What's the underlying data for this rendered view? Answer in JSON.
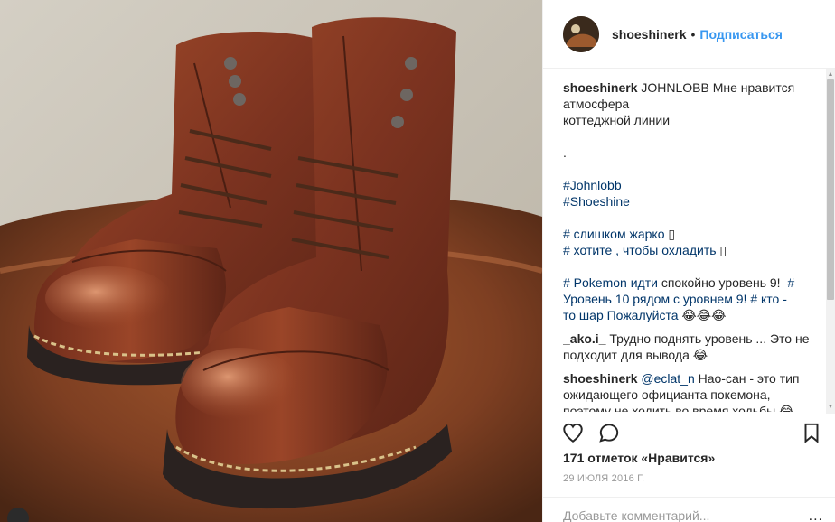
{
  "header": {
    "username": "shoeshinerk",
    "separator": "•",
    "follow_label": "Подписаться"
  },
  "caption": {
    "username": "shoeshinerk",
    "line1": " JOHNLOBB Мне нравится",
    "line2": "атмосфера",
    "line3": "коттеджной линии",
    "dot": ".",
    "tag_johnlobb": "#Johnlobb",
    "tag_shoeshine": "#Shoeshine",
    "tag_hot": "# слишком жарко",
    "hot_emoji": "▯",
    "tag_cool": "# хотите , чтобы охладить",
    "cool_emoji": "▯",
    "tag_pokemon": "# Pokemon идти",
    "pokemon_rest": " спокойно уровень 9!",
    "tag_level10": "#",
    "level_line2_tag": "Уровень 10 рядом с уровнем 9!",
    "tag_who": "# кто -",
    "level_line3_tag": "то шар Пожалуйста",
    "level_line3_emoji": " 😂😂😂"
  },
  "comments": [
    {
      "username": "_ako.i_",
      "text_line1": " Трудно поднять уровень ... Это не",
      "text_line2": "подходит для вывода",
      "emoji": " 😂"
    },
    {
      "username": "shoeshinerk",
      "mention": "@eclat_n",
      "text_line1": " Нао-сан - это тип",
      "text_line2": "ожидающего официанта покемона,",
      "text_line3": "поэтому не ходить во время ходьбы",
      "emoji": " 😂"
    }
  ],
  "actions": {
    "like_icon": "heart-icon",
    "comment_icon": "comment-icon",
    "save_icon": "bookmark-icon"
  },
  "likes_text": "171 отметок «Нравится»",
  "date_text": "29 июля 2016 г.",
  "add_comment": {
    "placeholder": "Добавьте комментарий...",
    "more": "..."
  },
  "colors": {
    "accent": "#3897f0",
    "hashtag": "#003569",
    "leather": "#8a3c22",
    "sole": "#2a2220"
  }
}
